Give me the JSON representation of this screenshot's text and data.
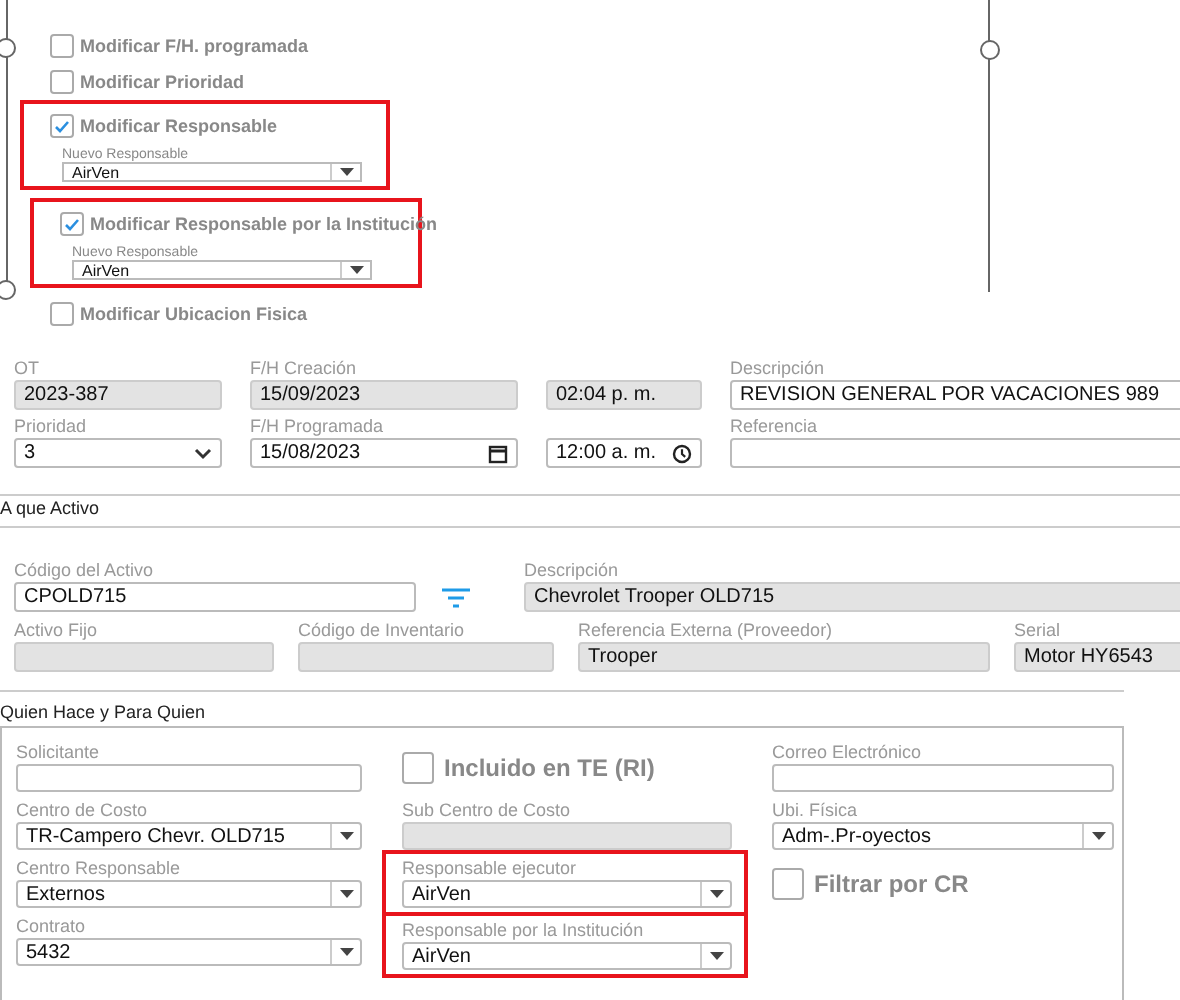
{
  "options_panel": {
    "items": [
      {
        "kind": "checkbox",
        "label": "Modificar F/H. programada",
        "checked": false
      },
      {
        "kind": "checkbox",
        "label": "Modificar Prioridad",
        "checked": false
      },
      {
        "kind": "checkbox_select",
        "label": "Modificar Responsable",
        "checked": true,
        "highlighted": true,
        "select_label": "Nuevo Responsable",
        "value": "AirVen"
      },
      {
        "kind": "checkbox_select",
        "label": "Modificar Responsable por la Institución",
        "checked": true,
        "highlighted": true,
        "select_label": "Nuevo Responsable",
        "value": "AirVen"
      },
      {
        "kind": "checkbox",
        "label": "Modificar Ubicacion Fisica",
        "checked": false
      }
    ]
  },
  "general": {
    "rows": [
      [
        {
          "kind": "readonly",
          "label": "OT",
          "value": "2023-387"
        },
        {
          "kind": "readonly",
          "label": "F/H Creación",
          "value": "15/09/2023"
        },
        {
          "kind": "readonly",
          "value": "02:04 p. m."
        },
        {
          "kind": "text",
          "label": "Descripción",
          "value": "REVISION GENERAL POR VACACIONES 989"
        }
      ],
      [
        {
          "kind": "chevron_select",
          "label": "Prioridad",
          "value": "3"
        },
        {
          "kind": "date",
          "label": "F/H Programada",
          "value": "15/08/2023"
        },
        {
          "kind": "time",
          "value": "12:00 a. m."
        },
        {
          "kind": "text",
          "label": "Referencia"
        }
      ]
    ]
  },
  "asset_section": {
    "title": "A que Activo",
    "rows": [
      [
        {
          "kind": "text",
          "label": "Código del Activo",
          "value": "CPOLD715"
        },
        {
          "kind": "filter_button"
        },
        {
          "kind": "readonly",
          "label": "Descripción",
          "value": "Chevrolet Trooper OLD715"
        }
      ],
      [
        {
          "kind": "readonly",
          "label": "Activo Fijo"
        },
        {
          "kind": "readonly",
          "label": "Código de Inventario"
        },
        {
          "kind": "readonly",
          "label": "Referencia Externa (Proveedor)",
          "value": "Trooper"
        },
        {
          "kind": "readonly",
          "label": "Serial",
          "value": "Motor HY6543"
        }
      ]
    ]
  },
  "who_section": {
    "title": "Quien Hace y Para Quien",
    "columns": [
      [
        {
          "kind": "text",
          "label": "Solicitante"
        },
        {
          "kind": "select",
          "label": "Centro de Costo",
          "value": "TR-Campero Chevr. OLD715"
        },
        {
          "kind": "select",
          "label": "Centro Responsable",
          "value": "Externos"
        },
        {
          "kind": "select",
          "label": "Contrato",
          "value": "5432"
        }
      ],
      [
        {
          "kind": "checkbox",
          "label": "Incluido en TE (RI)",
          "checked": false
        },
        {
          "kind": "readonly",
          "label": "Sub Centro de Costo"
        },
        {
          "kind": "select",
          "label": "Responsable ejecutor",
          "value": "AirVen",
          "highlighted": true
        },
        {
          "kind": "select",
          "label": "Responsable por la Institución",
          "value": "AirVen",
          "highlighted": true
        }
      ],
      [
        {
          "kind": "text",
          "label": "Correo Electrónico"
        },
        {
          "kind": "select",
          "label": "Ubi. Física",
          "value": "Adm-.Pr-oyectos"
        },
        {
          "kind": "checkbox",
          "label": "Filtrar por CR",
          "checked": false
        }
      ]
    ]
  }
}
